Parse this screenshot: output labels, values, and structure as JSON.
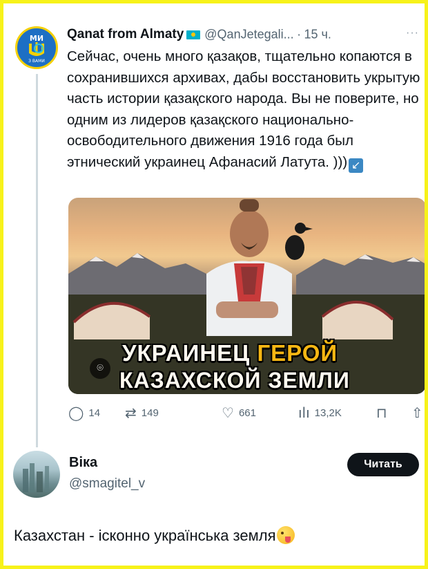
{
  "quoted_tweet": {
    "avatar_text": "МИ",
    "avatar_subtext": "З ВАМИ",
    "author_name": "Qanat from Almaty",
    "flag_icon": "kazakhstan-flag",
    "handle": "@QanJetegali...",
    "separator": "·",
    "time": "15 ч.",
    "more": "···",
    "text": "Сейчас, очень много қазақов, тщательно копаются в сохранившихся архивах, дабы восстановить укрытую часть истории қазақского народа. Вы не поверите, но одним из лидеров қазақского национально-освободительного движения 1916 года был этнический украинец Афанасий Латута. )))",
    "quote_icon": "arrow-down-left-icon",
    "media": {
      "title_word1": "УКРАИНЕЦ",
      "title_word2": "ГЕРОЙ",
      "title_line2": "КАЗАХСКОЙ ЗЕМЛИ",
      "lens_icon": "google-lens-icon"
    },
    "actions": {
      "replies": "14",
      "retweets": "149",
      "likes": "661",
      "views": "13,2K"
    }
  },
  "reply_tweet": {
    "author_name": "Віка",
    "handle": "@smagitel_v",
    "follow_label": "Читать",
    "text": "Казахстан - ісконно українська земля",
    "emoji": "winking-face-with-tongue"
  },
  "colors": {
    "border": "#f7f21a",
    "text": "#0f1419",
    "muted": "#536471",
    "accent_gold": "#f7b713"
  }
}
